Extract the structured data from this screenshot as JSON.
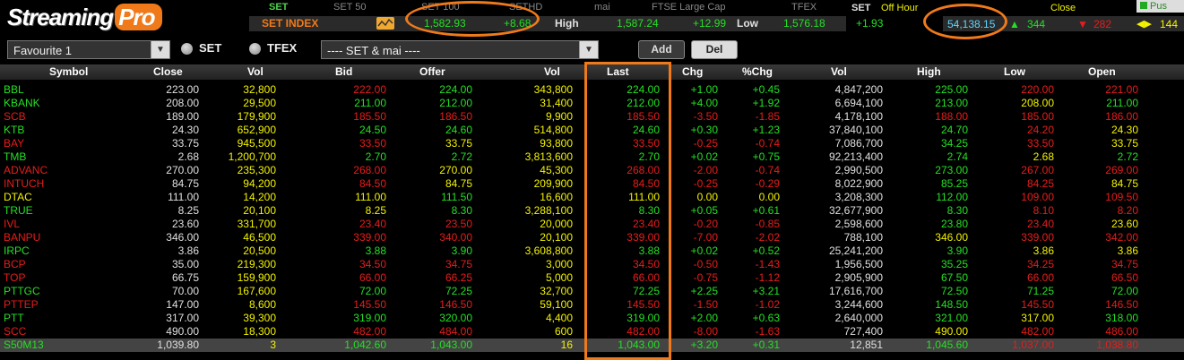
{
  "header": {
    "logo_left": "Streaming",
    "logo_right": "Pro",
    "markets": [
      "SET",
      "SET 50",
      "SET 100",
      "SETHD",
      "mai",
      "FTSE Large Cap",
      "TFEX"
    ],
    "index": {
      "name": "SET INDEX",
      "value": "1,582.93",
      "change": "+8.68",
      "high_label": "High",
      "high_value": "1,587.24",
      "high_change": "+12.99",
      "low_label": "Low",
      "low_value": "1,576.18",
      "low_change": "+1.93"
    },
    "right": {
      "set_label": "SET",
      "session": "Off Hour",
      "close_label": "Close",
      "push_label": "Pus",
      "value": "54,138.15",
      "ups": "344",
      "downs": "282",
      "unchanged": "144"
    }
  },
  "toolbar": {
    "favourite": "Favourite 1",
    "radio_set": "SET",
    "radio_tfex": "TFEX",
    "market_filter": "---- SET & mai ----",
    "add_label": "Add",
    "del_label": "Del"
  },
  "columns": [
    "Symbol",
    "Close",
    "Vol",
    "Bid",
    "Offer",
    "Vol",
    "Last",
    "Chg",
    "%Chg",
    "Vol",
    "High",
    "Low",
    "Open"
  ],
  "colors": {
    "up": "#24e024",
    "down": "#e81c1c",
    "unchanged": "#f2f200",
    "neutral": "#e0e0e0",
    "accent": "#f07a1a"
  },
  "rows": [
    {
      "symbol": "BBL",
      "close": "223.00",
      "vol1": "32,800",
      "bid": "222.00",
      "offer": "224.00",
      "vol2": "343,800",
      "last": "224.00",
      "chg": "+1.00",
      "pchg": "+0.45",
      "vol3": "4,847,200",
      "high": "225.00",
      "low": "220.00",
      "open": "221.00",
      "c": [
        "g",
        "w",
        "y",
        "r",
        "g",
        "y",
        "g",
        "g",
        "g",
        "w",
        "g",
        "r",
        "r"
      ]
    },
    {
      "symbol": "KBANK",
      "close": "208.00",
      "vol1": "29,500",
      "bid": "211.00",
      "offer": "212.00",
      "vol2": "31,400",
      "last": "212.00",
      "chg": "+4.00",
      "pchg": "+1.92",
      "vol3": "6,694,100",
      "high": "213.00",
      "low": "208.00",
      "open": "211.00",
      "c": [
        "g",
        "w",
        "y",
        "g",
        "g",
        "y",
        "g",
        "g",
        "g",
        "w",
        "g",
        "y",
        "g"
      ]
    },
    {
      "symbol": "SCB",
      "close": "189.00",
      "vol1": "179,900",
      "bid": "185.50",
      "offer": "186.50",
      "vol2": "9,900",
      "last": "185.50",
      "chg": "-3.50",
      "pchg": "-1.85",
      "vol3": "4,178,100",
      "high": "188.00",
      "low": "185.00",
      "open": "186.00",
      "c": [
        "r",
        "w",
        "y",
        "r",
        "r",
        "y",
        "r",
        "r",
        "r",
        "w",
        "r",
        "r",
        "r"
      ]
    },
    {
      "symbol": "KTB",
      "close": "24.30",
      "vol1": "652,900",
      "bid": "24.50",
      "offer": "24.60",
      "vol2": "514,800",
      "last": "24.60",
      "chg": "+0.30",
      "pchg": "+1.23",
      "vol3": "37,840,100",
      "high": "24.70",
      "low": "24.20",
      "open": "24.30",
      "c": [
        "g",
        "w",
        "y",
        "g",
        "g",
        "y",
        "g",
        "g",
        "g",
        "w",
        "g",
        "r",
        "y"
      ]
    },
    {
      "symbol": "BAY",
      "close": "33.75",
      "vol1": "945,500",
      "bid": "33.50",
      "offer": "33.75",
      "vol2": "93,800",
      "last": "33.50",
      "chg": "-0.25",
      "pchg": "-0.74",
      "vol3": "7,086,700",
      "high": "34.25",
      "low": "33.50",
      "open": "33.75",
      "c": [
        "r",
        "w",
        "y",
        "r",
        "y",
        "y",
        "r",
        "r",
        "r",
        "w",
        "g",
        "r",
        "y"
      ]
    },
    {
      "symbol": "TMB",
      "close": "2.68",
      "vol1": "1,200,700",
      "bid": "2.70",
      "offer": "2.72",
      "vol2": "3,813,600",
      "last": "2.70",
      "chg": "+0.02",
      "pchg": "+0.75",
      "vol3": "92,213,400",
      "high": "2.74",
      "low": "2.68",
      "open": "2.72",
      "c": [
        "g",
        "w",
        "y",
        "g",
        "g",
        "y",
        "g",
        "g",
        "g",
        "w",
        "g",
        "y",
        "g"
      ]
    },
    {
      "symbol": "ADVANC",
      "close": "270.00",
      "vol1": "235,300",
      "bid": "268.00",
      "offer": "270.00",
      "vol2": "45,300",
      "last": "268.00",
      "chg": "-2.00",
      "pchg": "-0.74",
      "vol3": "2,990,500",
      "high": "273.00",
      "low": "267.00",
      "open": "269.00",
      "c": [
        "r",
        "w",
        "y",
        "r",
        "y",
        "y",
        "r",
        "r",
        "r",
        "w",
        "g",
        "r",
        "r"
      ]
    },
    {
      "symbol": "INTUCH",
      "close": "84.75",
      "vol1": "94,200",
      "bid": "84.50",
      "offer": "84.75",
      "vol2": "209,900",
      "last": "84.50",
      "chg": "-0.25",
      "pchg": "-0.29",
      "vol3": "8,022,900",
      "high": "85.25",
      "low": "84.25",
      "open": "84.75",
      "c": [
        "r",
        "w",
        "y",
        "r",
        "y",
        "y",
        "r",
        "r",
        "r",
        "w",
        "g",
        "r",
        "y"
      ]
    },
    {
      "symbol": "DTAC",
      "close": "111.00",
      "vol1": "14,200",
      "bid": "111.00",
      "offer": "111.50",
      "vol2": "16,600",
      "last": "111.00",
      "chg": "0.00",
      "pchg": "0.00",
      "vol3": "3,208,300",
      "high": "112.00",
      "low": "109.00",
      "open": "109.50",
      "c": [
        "y",
        "w",
        "y",
        "y",
        "g",
        "y",
        "y",
        "y",
        "y",
        "w",
        "g",
        "r",
        "r"
      ]
    },
    {
      "symbol": "TRUE",
      "close": "8.25",
      "vol1": "20,100",
      "bid": "8.25",
      "offer": "8.30",
      "vol2": "3,288,100",
      "last": "8.30",
      "chg": "+0.05",
      "pchg": "+0.61",
      "vol3": "32,677,900",
      "high": "8.30",
      "low": "8.10",
      "open": "8.20",
      "c": [
        "g",
        "w",
        "y",
        "y",
        "g",
        "y",
        "g",
        "g",
        "g",
        "w",
        "g",
        "r",
        "r"
      ]
    },
    {
      "symbol": "IVL",
      "close": "23.60",
      "vol1": "331,700",
      "bid": "23.40",
      "offer": "23.50",
      "vol2": "20,000",
      "last": "23.40",
      "chg": "-0.20",
      "pchg": "-0.85",
      "vol3": "2,598,600",
      "high": "23.80",
      "low": "23.40",
      "open": "23.60",
      "c": [
        "r",
        "w",
        "y",
        "r",
        "r",
        "y",
        "r",
        "r",
        "r",
        "w",
        "g",
        "r",
        "y"
      ]
    },
    {
      "symbol": "BANPU",
      "close": "346.00",
      "vol1": "46,500",
      "bid": "339.00",
      "offer": "340.00",
      "vol2": "20,100",
      "last": "339.00",
      "chg": "-7.00",
      "pchg": "-2.02",
      "vol3": "788,100",
      "high": "346.00",
      "low": "339.00",
      "open": "342.00",
      "c": [
        "r",
        "w",
        "y",
        "r",
        "r",
        "y",
        "r",
        "r",
        "r",
        "w",
        "y",
        "r",
        "r"
      ]
    },
    {
      "symbol": "IRPC",
      "close": "3.86",
      "vol1": "20,500",
      "bid": "3.88",
      "offer": "3.90",
      "vol2": "3,608,800",
      "last": "3.88",
      "chg": "+0.02",
      "pchg": "+0.52",
      "vol3": "25,241,200",
      "high": "3.90",
      "low": "3.86",
      "open": "3.86",
      "c": [
        "g",
        "w",
        "y",
        "g",
        "g",
        "y",
        "g",
        "g",
        "g",
        "w",
        "g",
        "y",
        "y"
      ]
    },
    {
      "symbol": "BCP",
      "close": "35.00",
      "vol1": "219,300",
      "bid": "34.50",
      "offer": "34.75",
      "vol2": "3,000",
      "last": "34.50",
      "chg": "-0.50",
      "pchg": "-1.43",
      "vol3": "1,956,500",
      "high": "35.25",
      "low": "34.25",
      "open": "34.75",
      "c": [
        "r",
        "w",
        "y",
        "r",
        "r",
        "y",
        "r",
        "r",
        "r",
        "w",
        "g",
        "r",
        "r"
      ]
    },
    {
      "symbol": "TOP",
      "close": "66.75",
      "vol1": "159,900",
      "bid": "66.00",
      "offer": "66.25",
      "vol2": "5,000",
      "last": "66.00",
      "chg": "-0.75",
      "pchg": "-1.12",
      "vol3": "2,905,900",
      "high": "67.50",
      "low": "66.00",
      "open": "66.50",
      "c": [
        "r",
        "w",
        "y",
        "r",
        "r",
        "y",
        "r",
        "r",
        "r",
        "w",
        "g",
        "r",
        "r"
      ]
    },
    {
      "symbol": "PTTGC",
      "close": "70.00",
      "vol1": "167,600",
      "bid": "72.00",
      "offer": "72.25",
      "vol2": "32,700",
      "last": "72.25",
      "chg": "+2.25",
      "pchg": "+3.21",
      "vol3": "17,616,700",
      "high": "72.50",
      "low": "71.25",
      "open": "72.00",
      "c": [
        "g",
        "w",
        "y",
        "g",
        "g",
        "y",
        "g",
        "g",
        "g",
        "w",
        "g",
        "g",
        "g"
      ]
    },
    {
      "symbol": "PTTEP",
      "close": "147.00",
      "vol1": "8,600",
      "bid": "145.50",
      "offer": "146.50",
      "vol2": "59,100",
      "last": "145.50",
      "chg": "-1.50",
      "pchg": "-1.02",
      "vol3": "3,244,600",
      "high": "148.50",
      "low": "145.50",
      "open": "146.50",
      "c": [
        "r",
        "w",
        "y",
        "r",
        "r",
        "y",
        "r",
        "r",
        "r",
        "w",
        "g",
        "r",
        "r"
      ]
    },
    {
      "symbol": "PTT",
      "close": "317.00",
      "vol1": "39,300",
      "bid": "319.00",
      "offer": "320.00",
      "vol2": "4,400",
      "last": "319.00",
      "chg": "+2.00",
      "pchg": "+0.63",
      "vol3": "2,640,000",
      "high": "321.00",
      "low": "317.00",
      "open": "318.00",
      "c": [
        "g",
        "w",
        "y",
        "g",
        "g",
        "y",
        "g",
        "g",
        "g",
        "w",
        "g",
        "y",
        "g"
      ]
    },
    {
      "symbol": "SCC",
      "close": "490.00",
      "vol1": "18,300",
      "bid": "482.00",
      "offer": "484.00",
      "vol2": "600",
      "last": "482.00",
      "chg": "-8.00",
      "pchg": "-1.63",
      "vol3": "727,400",
      "high": "490.00",
      "low": "482.00",
      "open": "486.00",
      "c": [
        "r",
        "w",
        "y",
        "r",
        "r",
        "y",
        "r",
        "r",
        "r",
        "w",
        "y",
        "r",
        "r"
      ]
    },
    {
      "symbol": "S50M13",
      "close": "1,039.80",
      "vol1": "3",
      "bid": "1,042.60",
      "offer": "1,043.00",
      "vol2": "16",
      "last": "1,043.00",
      "chg": "+3.20",
      "pchg": "+0.31",
      "vol3": "12,851",
      "high": "1,045.60",
      "low": "1,037.00",
      "open": "1,038.80",
      "c": [
        "g",
        "w",
        "y",
        "g",
        "g",
        "y",
        "g",
        "g",
        "g",
        "w",
        "g",
        "r",
        "r"
      ]
    }
  ]
}
